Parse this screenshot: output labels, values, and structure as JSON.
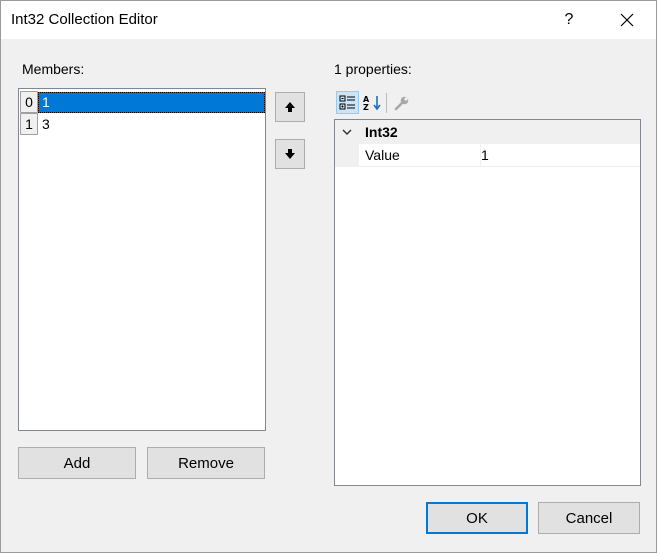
{
  "window": {
    "title": "Int32 Collection Editor",
    "help_label": "?",
    "close_label": "✕"
  },
  "members": {
    "label": "Members:",
    "items": [
      {
        "index": "0",
        "value": "1",
        "selected": true
      },
      {
        "index": "1",
        "value": "3",
        "selected": false
      }
    ],
    "add_label": "Add",
    "remove_label": "Remove"
  },
  "properties": {
    "label": "1 properties:",
    "category": "Int32",
    "rows": [
      {
        "name": "Value",
        "value": "1"
      }
    ]
  },
  "footer": {
    "ok_label": "OK",
    "cancel_label": "Cancel"
  },
  "icons": {
    "move_up": "arrow-up-icon",
    "move_down": "arrow-down-icon",
    "categorized": "categorized-icon",
    "alphabetical": "alphabetical-sort-icon",
    "property_pages": "wrench-icon",
    "collapse": "chevron-down-icon"
  },
  "colors": {
    "selection": "#0078d7",
    "default_button_border": "#0078d7"
  }
}
